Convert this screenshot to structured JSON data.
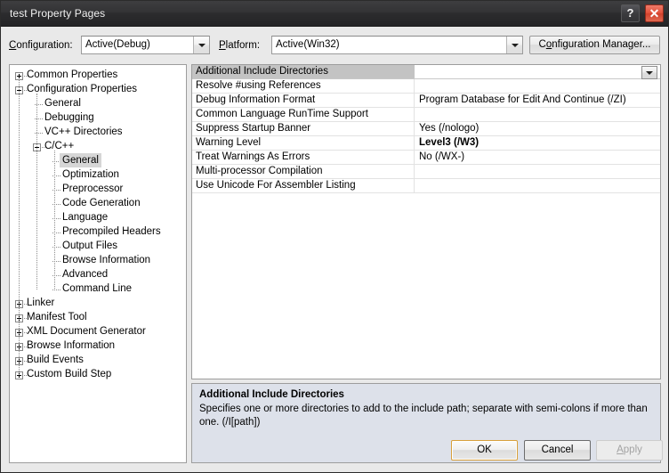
{
  "window": {
    "title": "test Property Pages",
    "help_button": "?",
    "close_button": "✕"
  },
  "toolbar": {
    "configuration_label": "Configuration:",
    "configuration_value": "Active(Debug)",
    "platform_label": "Platform:",
    "platform_value": "Active(Win32)",
    "configuration_manager_label": "Configuration Manager..."
  },
  "tree": {
    "items": [
      {
        "label": "Common Properties",
        "depth": 0,
        "expander": "plus",
        "selected": false
      },
      {
        "label": "Configuration Properties",
        "depth": 0,
        "expander": "minus",
        "selected": false
      },
      {
        "label": "General",
        "depth": 1,
        "expander": "none",
        "selected": false
      },
      {
        "label": "Debugging",
        "depth": 1,
        "expander": "none",
        "selected": false
      },
      {
        "label": "VC++ Directories",
        "depth": 1,
        "expander": "none",
        "selected": false
      },
      {
        "label": "C/C++",
        "depth": 1,
        "expander": "minus",
        "selected": false
      },
      {
        "label": "General",
        "depth": 2,
        "expander": "none",
        "selected": true
      },
      {
        "label": "Optimization",
        "depth": 2,
        "expander": "none",
        "selected": false
      },
      {
        "label": "Preprocessor",
        "depth": 2,
        "expander": "none",
        "selected": false
      },
      {
        "label": "Code Generation",
        "depth": 2,
        "expander": "none",
        "selected": false
      },
      {
        "label": "Language",
        "depth": 2,
        "expander": "none",
        "selected": false
      },
      {
        "label": "Precompiled Headers",
        "depth": 2,
        "expander": "none",
        "selected": false
      },
      {
        "label": "Output Files",
        "depth": 2,
        "expander": "none",
        "selected": false
      },
      {
        "label": "Browse Information",
        "depth": 2,
        "expander": "none",
        "selected": false
      },
      {
        "label": "Advanced",
        "depth": 2,
        "expander": "none",
        "selected": false
      },
      {
        "label": "Command Line",
        "depth": 2,
        "expander": "none",
        "selected": false
      },
      {
        "label": "Linker",
        "depth": 0,
        "expander": "plus",
        "selected": false
      },
      {
        "label": "Manifest Tool",
        "depth": 0,
        "expander": "plus",
        "selected": false
      },
      {
        "label": "XML Document Generator",
        "depth": 0,
        "expander": "plus",
        "selected": false
      },
      {
        "label": "Browse Information",
        "depth": 0,
        "expander": "plus",
        "selected": false
      },
      {
        "label": "Build Events",
        "depth": 0,
        "expander": "plus",
        "selected": false
      },
      {
        "label": "Custom Build Step",
        "depth": 0,
        "expander": "plus",
        "selected": false
      }
    ]
  },
  "grid": {
    "rows": [
      {
        "name": "Additional Include Directories",
        "value": "",
        "selected": true,
        "bold": false,
        "dropdown": true
      },
      {
        "name": "Resolve #using References",
        "value": "",
        "selected": false,
        "bold": false,
        "dropdown": false
      },
      {
        "name": "Debug Information Format",
        "value": "Program Database for Edit And Continue (/ZI)",
        "selected": false,
        "bold": false,
        "dropdown": false
      },
      {
        "name": "Common Language RunTime Support",
        "value": "",
        "selected": false,
        "bold": false,
        "dropdown": false
      },
      {
        "name": "Suppress Startup Banner",
        "value": "Yes (/nologo)",
        "selected": false,
        "bold": false,
        "dropdown": false
      },
      {
        "name": "Warning Level",
        "value": "Level3 (/W3)",
        "selected": false,
        "bold": true,
        "dropdown": false
      },
      {
        "name": "Treat Warnings As Errors",
        "value": "No (/WX-)",
        "selected": false,
        "bold": false,
        "dropdown": false
      },
      {
        "name": "Multi-processor Compilation",
        "value": "",
        "selected": false,
        "bold": false,
        "dropdown": false
      },
      {
        "name": "Use Unicode For Assembler Listing",
        "value": "",
        "selected": false,
        "bold": false,
        "dropdown": false
      }
    ]
  },
  "description": {
    "title": "Additional Include Directories",
    "body": "Specifies one or more directories to add to the include path; separate with semi-colons if more than one. (/I[path])"
  },
  "footer": {
    "ok_label": "OK",
    "cancel_label": "Cancel",
    "apply_label": "Apply"
  },
  "colors": {
    "titlebar_dark": "#333335",
    "close_red": "#e2513a",
    "ok_focus_gold": "#d8a03b",
    "description_bg": "#dde1ea",
    "selection_gray": "#c3c3c3"
  }
}
